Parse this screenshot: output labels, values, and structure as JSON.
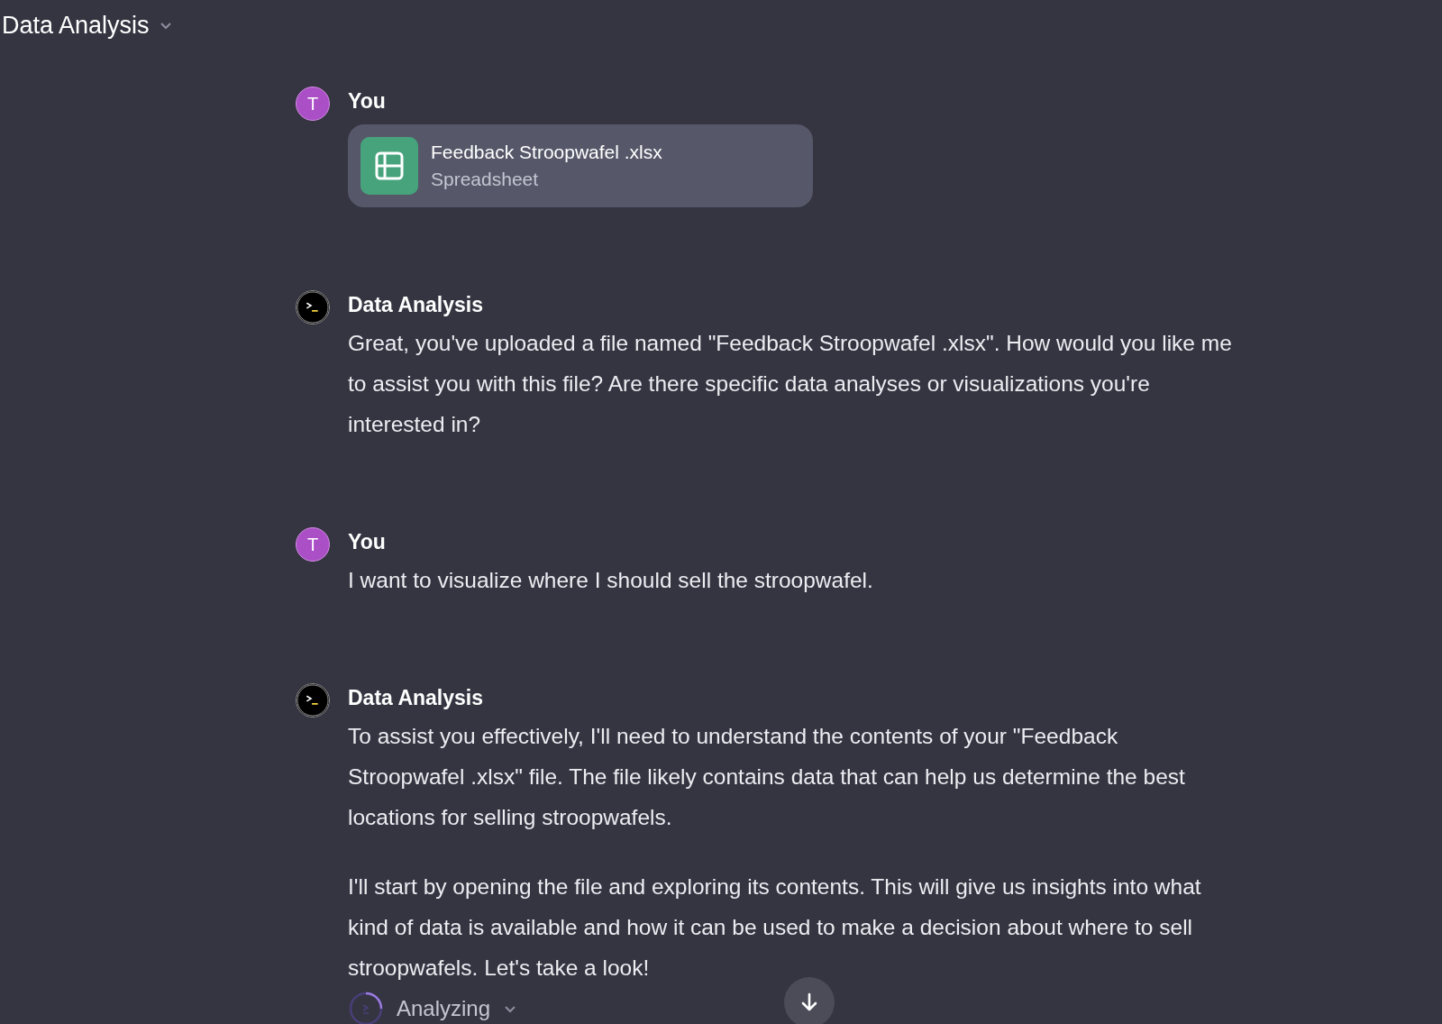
{
  "header": {
    "title": "Data Analysis"
  },
  "messages": [
    {
      "kind": "user",
      "avatar": "T",
      "author": "You",
      "attachment": {
        "name": "Feedback Stroopwafel .xlsx",
        "type": "Spreadsheet"
      }
    },
    {
      "kind": "assistant",
      "author": "Data Analysis",
      "paragraphs": [
        "Great, you've uploaded a file named \"Feedback Stroopwafel .xlsx\". How would you like me to assist you with this file? Are there specific data analyses or visualizations you're interested in?"
      ]
    },
    {
      "kind": "user",
      "avatar": "T",
      "author": "You",
      "paragraphs": [
        "I want to visualize where I should sell the stroopwafel."
      ]
    },
    {
      "kind": "assistant",
      "author": "Data Analysis",
      "paragraphs": [
        "To assist you effectively, I'll need to understand the contents of your \"Feedback Stroopwafel .xlsx\" file. The file likely contains data that can help us determine the best locations for selling stroopwafels.",
        "I'll start by opening the file and exploring its contents. This will give us insights into what kind of data is available and how it can be used to make a decision about where to sell stroopwafels. Let's take a look!"
      ],
      "status": "Analyzing"
    }
  ]
}
